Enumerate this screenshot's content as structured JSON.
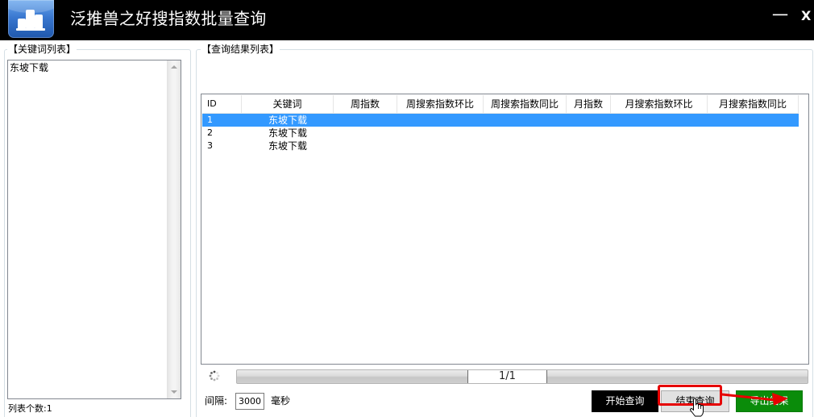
{
  "window": {
    "title": "泛推兽之好搜指数批量查询",
    "app_icon": "bar-chart-icon",
    "minimize_label": "一",
    "close_label": "X"
  },
  "colors": {
    "title_bar": "#000000",
    "selection": "#3399ff",
    "start_button": "#000000",
    "stop_button": "#e1e1e1",
    "export_button": "#0a8c0a",
    "annotation": "#e60000"
  },
  "keywords_panel": {
    "label": "【关键词列表】",
    "items": [
      "东坡下载"
    ],
    "count_text": "列表个数:1"
  },
  "results_panel": {
    "label": "【查询结果列表】",
    "columns": [
      "ID",
      "关键词",
      "周指数",
      "周搜索指数环比",
      "周搜索指数同比",
      "月指数",
      "月搜索指数环比",
      "月搜索指数同比"
    ],
    "rows": [
      {
        "id": "1",
        "keyword": "东坡下载",
        "selected": true
      },
      {
        "id": "2",
        "keyword": "东坡下载",
        "selected": false
      },
      {
        "id": "3",
        "keyword": "东坡下载",
        "selected": false
      }
    ]
  },
  "progress": {
    "loading_icon": "spinner-icon",
    "text": "1/1"
  },
  "controls": {
    "interval_label": "间隔:",
    "interval_value": "3000",
    "interval_unit": "毫秒",
    "start_label": "开始查询",
    "stop_label": "结束查询",
    "export_label": "导出结果"
  },
  "overlay": {
    "cursor_icon": "hand-cursor-icon",
    "arrow_icon": "arrow-right-icon"
  }
}
